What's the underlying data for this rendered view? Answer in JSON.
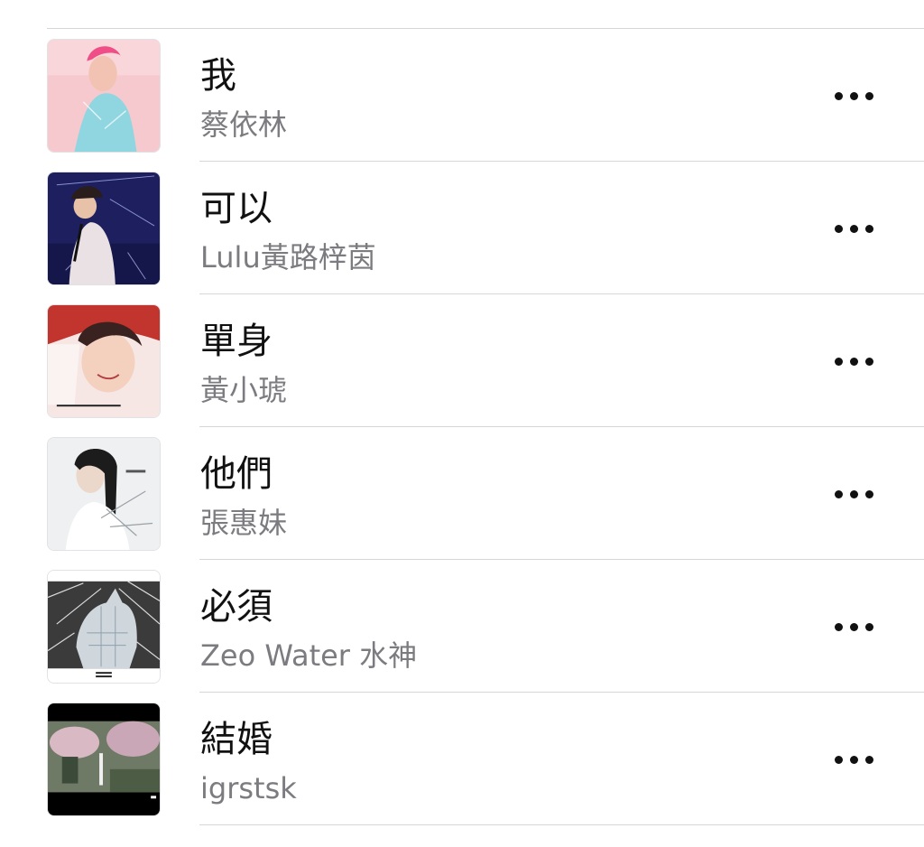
{
  "songs": [
    {
      "title": "我",
      "artist": "蔡依林",
      "artwork": "album-art-pink-portrait"
    },
    {
      "title": "可以",
      "artist": "Lulu黃路梓茵",
      "artwork": "album-art-navy-stage"
    },
    {
      "title": "單身",
      "artist": "黃小琥",
      "artwork": "album-art-red-portrait"
    },
    {
      "title": "他們",
      "artist": "張惠妹",
      "artwork": "album-art-white-portrait"
    },
    {
      "title": "必須",
      "artist": "Zeo Water 水神",
      "artwork": "album-art-dog-sculpture"
    },
    {
      "title": "結婚",
      "artist": "igrstsk",
      "artwork": "album-art-cherry-blossom-photo"
    }
  ],
  "more_icon": "more-horizontal-icon"
}
